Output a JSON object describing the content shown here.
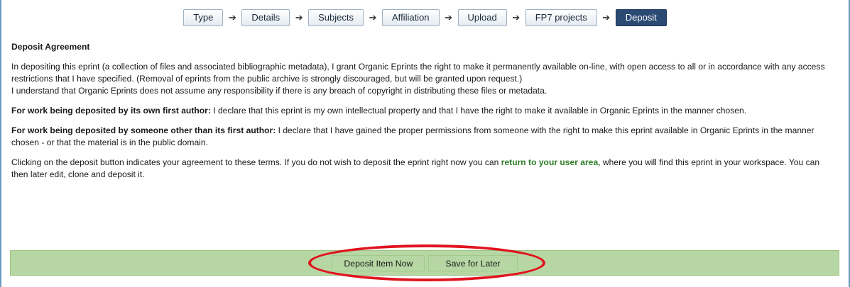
{
  "workflow": {
    "steps": [
      {
        "label": "Type"
      },
      {
        "label": "Details"
      },
      {
        "label": "Subjects"
      },
      {
        "label": "Affiliation"
      },
      {
        "label": "Upload"
      },
      {
        "label": "FP7 projects"
      },
      {
        "label": "Deposit",
        "current": true
      }
    ],
    "arrow_icon": "right-arrow-icon"
  },
  "agreement": {
    "heading": "Deposit Agreement",
    "para1": "In depositing this eprint (a collection of files and associated bibliographic metadata), I grant Organic Eprints the right to make it permanently available on-line, with open access to all or in accordance with any access restrictions that I have specified. (Removal of eprints from the public archive is strongly discouraged, but will be granted upon request.)",
    "para1b": "I understand that Organic Eprints does not assume any responsibility if there is any breach of copyright in distributing these files or metadata.",
    "first_author_label": "For work being deposited by its own first author:",
    "first_author_text": " I declare that this eprint is my own intellectual property and that I have the right to make it available in Organic Eprints in the manner chosen.",
    "other_author_label": "For work being deposited by someone other than its first author:",
    "other_author_text": " I declare that I have gained the proper permissions from someone with the right to make this eprint available in Organic Eprints in the manner chosen - or that the material is in the public domain.",
    "closing_before": "Clicking on the deposit button indicates your agreement to these terms. If you do not wish to deposit the eprint right now you can ",
    "closing_link": "return to your user area",
    "closing_after": ", where you will find this eprint in your workspace. You can then later edit, clone and deposit it."
  },
  "buttons": {
    "deposit_label": "Deposit Item Now",
    "save_label": "Save for Later"
  },
  "colors": {
    "current_step_bg": "#2a4a73",
    "button_bar_bg": "#b6d7a3",
    "link_green": "#2d7d26",
    "highlight_red": "#e0141e"
  }
}
